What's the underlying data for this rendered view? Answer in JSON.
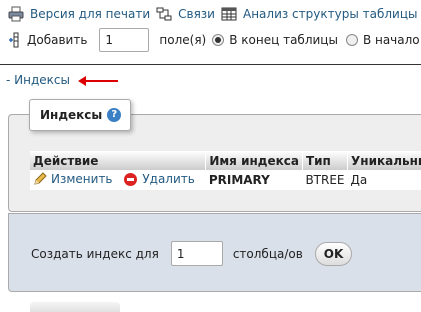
{
  "top_links": {
    "print": "Версия для печати",
    "relations": "Связи",
    "analyze": "Анализ структуры таблицы"
  },
  "add_row": {
    "add_label": "Добавить",
    "count_value": "1",
    "fields_label": "поле(я)",
    "end_label": "В конец таблицы",
    "begin_label": "В начало"
  },
  "indexes_toggle": "- Индексы",
  "indexes_panel": {
    "legend": "Индексы",
    "help_glyph": "?",
    "columns": [
      "Действие",
      "Имя индекса",
      "Тип",
      "Уникальный"
    ],
    "rows": [
      {
        "edit": "Изменить",
        "delete": "Удалить",
        "name": "PRIMARY",
        "type": "BTREE",
        "unique": "Да"
      }
    ]
  },
  "create_index": {
    "prefix": "Создать индекс для",
    "count_value": "1",
    "suffix": "столбца/ов",
    "ok": "OK"
  },
  "colors": {
    "link": "#235a81",
    "panel_bg": "#eeeeee",
    "create_bg": "#d9e0ea",
    "arrow": "#dd0000"
  }
}
